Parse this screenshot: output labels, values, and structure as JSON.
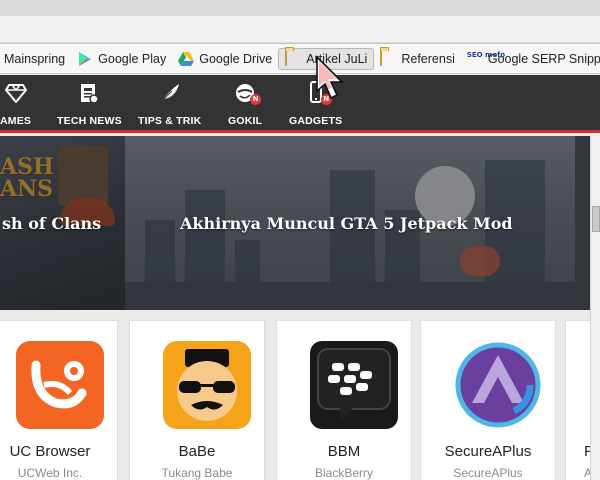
{
  "bookmarks": [
    {
      "label": "Mainspring",
      "icon": "bookmark-blank-icon"
    },
    {
      "label": "Google Play",
      "icon": "google-play-icon"
    },
    {
      "label": "Google Drive",
      "icon": "google-drive-icon"
    },
    {
      "label": "Artikel JuLi",
      "icon": "folder-icon",
      "hovered": true
    },
    {
      "label": "Referensi",
      "icon": "folder-icon"
    },
    {
      "label": "Google SERP Snippe...",
      "icon": "seo-mofo-icon",
      "icon_text": "SEO mofo"
    }
  ],
  "nav": [
    {
      "label": "GAMES",
      "visible_label": "AMES",
      "icon": "diamond-icon"
    },
    {
      "label": "TECH NEWS",
      "icon": "newspaper-icon"
    },
    {
      "label": "TIPS & TRIK",
      "icon": "feather-icon"
    },
    {
      "label": "GOKIL",
      "icon": "troll-face-icon",
      "badge": "N"
    },
    {
      "label": "GADGETS",
      "icon": "phone-icon",
      "badge": "N"
    }
  ],
  "banner": {
    "slides": [
      {
        "title": "sh of Clans",
        "art_text": "ASH\nANS"
      },
      {
        "title": "Akhirnya Muncul GTA 5 Jetpack Mod"
      },
      {
        "title": ""
      }
    ]
  },
  "apps": [
    {
      "name": "UC Browser",
      "developer": "UCWeb Inc.",
      "icon": "uc-browser-icon",
      "color": "#f26522"
    },
    {
      "name": "BaBe",
      "developer": "Tukang Babe",
      "icon": "babe-icon",
      "color": "#f5a31a"
    },
    {
      "name": "BBM",
      "developer": "BlackBerry",
      "icon": "bbm-icon",
      "color": "#1a1a1a"
    },
    {
      "name": "SecureAPlus",
      "developer": "SecureAPlus",
      "icon": "secureaplus-icon",
      "color": "#6a3fa0"
    },
    {
      "name": "Ph",
      "developer": "Ado",
      "icon": "partial-app-icon",
      "color": "#2a2a5a"
    }
  ],
  "colors": {
    "accent": "#d32f2f",
    "nav_bg": "#333333"
  }
}
